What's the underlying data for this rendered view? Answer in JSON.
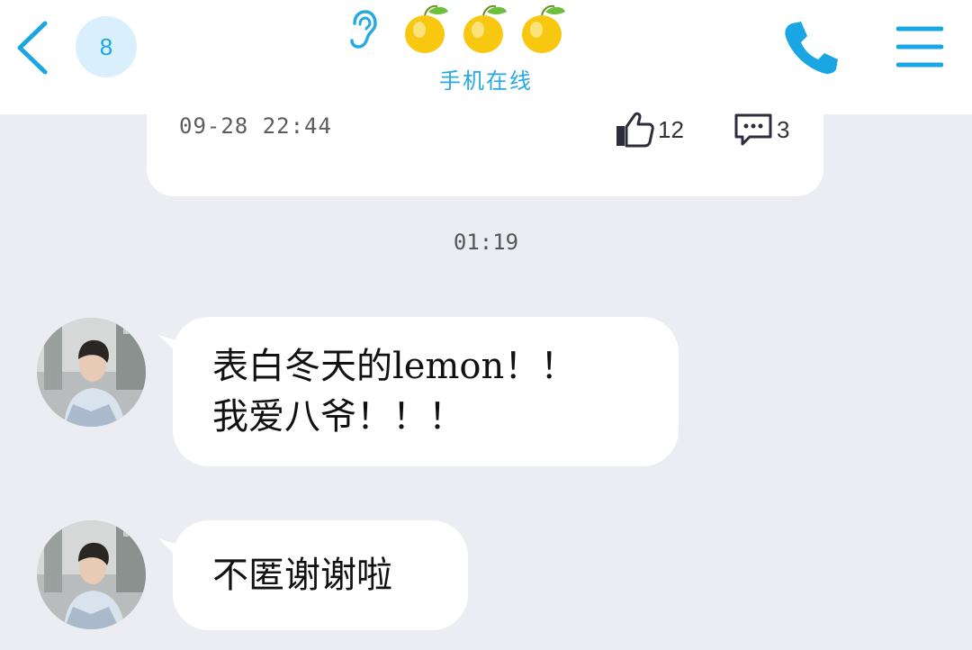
{
  "header": {
    "unread_count": "8",
    "status": "手机在线",
    "icons": {
      "back": "back-chevron-icon",
      "ear": "ear-icon",
      "lemon": "lemon-icon",
      "phone": "phone-icon",
      "menu": "menu-icon"
    }
  },
  "post": {
    "time": "09-28 22:44",
    "likes": "12",
    "comments": "3",
    "icons": {
      "like": "thumbs-up-icon",
      "comment": "comment-icon"
    }
  },
  "conversation": {
    "time_divider": "01:19",
    "messages": [
      {
        "lines": [
          "表白冬天的lemon！！",
          "我爱八爷！！！"
        ]
      },
      {
        "lines": [
          "不匿谢谢啦"
        ]
      }
    ]
  },
  "colors": {
    "accent": "#1aa6e3",
    "background": "#ebedf2",
    "bubble": "#ffffff",
    "lemon": "#f7c80f"
  }
}
